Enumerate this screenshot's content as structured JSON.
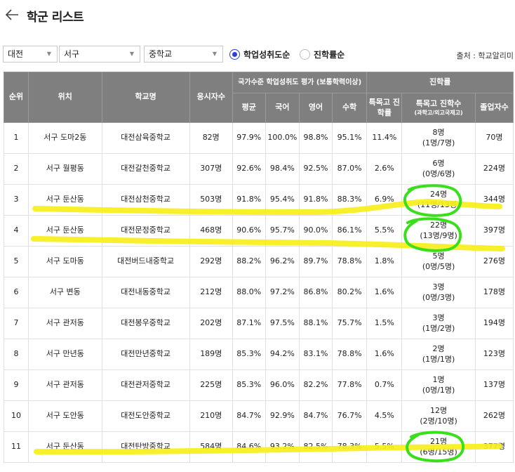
{
  "header": {
    "title": "학군 리스트"
  },
  "filters": {
    "city": "대전",
    "district": "서구",
    "school_type": "중학교",
    "sort_options": [
      {
        "label": "학업성취도순",
        "selected": true
      },
      {
        "label": "진학률순",
        "selected": false
      }
    ],
    "source": "출처 : 학교알리미"
  },
  "table": {
    "headers": {
      "rank": "순위",
      "location": "위치",
      "school": "학교명",
      "applicants": "응시자수",
      "achievement_group": "국가수준 학업성취도 평가 (보통학력이상)",
      "avg": "평균",
      "korean": "국어",
      "english": "영어",
      "math": "수학",
      "advancement_group": "진학률",
      "special_rate": "특목고 진학률",
      "special_count": "특목고 진학수",
      "special_count_sub": "(과학고/외고국제고)",
      "graduates": "졸업자수"
    },
    "rows": [
      {
        "rank": "1",
        "location": "서구 도마2동",
        "school": "대전삼육중학교",
        "applicants": "82명",
        "avg": "97.9%",
        "korean": "100.0%",
        "english": "98.8%",
        "math": "95.1%",
        "special_rate": "11.4%",
        "count": "8명",
        "count_detail": "(1명/7명)",
        "graduates": "70명"
      },
      {
        "rank": "2",
        "location": "서구 월평동",
        "school": "대전갈천중학교",
        "applicants": "307명",
        "avg": "92.6%",
        "korean": "98.4%",
        "english": "92.5%",
        "math": "87.0%",
        "special_rate": "2.6%",
        "count": "6명",
        "count_detail": "(0명/6명)",
        "graduates": "224명"
      },
      {
        "rank": "3",
        "location": "서구 둔산동",
        "school": "대전삼천중학교",
        "applicants": "503명",
        "avg": "91.8%",
        "korean": "95.4%",
        "english": "91.8%",
        "math": "88.3%",
        "special_rate": "6.9%",
        "count": "24명",
        "count_detail": "(11명/13명)",
        "graduates": "344명"
      },
      {
        "rank": "4",
        "location": "서구 둔산동",
        "school": "대전문정중학교",
        "applicants": "468명",
        "avg": "90.6%",
        "korean": "95.7%",
        "english": "90.0%",
        "math": "86.1%",
        "special_rate": "5.5%",
        "count": "22명",
        "count_detail": "(13명/9명)",
        "graduates": "397명"
      },
      {
        "rank": "5",
        "location": "서구 도마동",
        "school": "대전버드내중학교",
        "applicants": "292명",
        "avg": "88.2%",
        "korean": "96.2%",
        "english": "89.7%",
        "math": "78.8%",
        "special_rate": "1.8%",
        "count": "5명",
        "count_detail": "(0명/5명)",
        "graduates": "276명"
      },
      {
        "rank": "6",
        "location": "서구 변동",
        "school": "대전내동중학교",
        "applicants": "212명",
        "avg": "88.0%",
        "korean": "97.2%",
        "english": "86.8%",
        "math": "80.2%",
        "special_rate": "1.6%",
        "count": "3명",
        "count_detail": "(0명/3명)",
        "graduates": "178명"
      },
      {
        "rank": "7",
        "location": "서구 관저동",
        "school": "대전봉우중학교",
        "applicants": "202명",
        "avg": "87.1%",
        "korean": "97.5%",
        "english": "88.1%",
        "math": "75.7%",
        "special_rate": "1.5%",
        "count": "3명",
        "count_detail": "(1명/2명)",
        "graduates": "194명"
      },
      {
        "rank": "8",
        "location": "서구 만년동",
        "school": "대전만년중학교",
        "applicants": "189명",
        "avg": "85.3%",
        "korean": "94.2%",
        "english": "83.1%",
        "math": "78.8%",
        "special_rate": "1.6%",
        "count": "2명",
        "count_detail": "(1명/1명)",
        "graduates": "123명"
      },
      {
        "rank": "9",
        "location": "서구 관저동",
        "school": "대전관저중학교",
        "applicants": "225명",
        "avg": "85.3%",
        "korean": "96.0%",
        "english": "82.2%",
        "math": "77.8%",
        "special_rate": "0.7%",
        "count": "1명",
        "count_detail": "(0명/1명)",
        "graduates": "137명"
      },
      {
        "rank": "10",
        "location": "서구 도안동",
        "school": "대전도안중학교",
        "applicants": "210명",
        "avg": "84.7%",
        "korean": "92.9%",
        "english": "84.7%",
        "math": "76.7%",
        "special_rate": "4.5%",
        "count": "12명",
        "count_detail": "(2명/10명)",
        "graduates": "262명"
      },
      {
        "rank": "11",
        "location": "서구 둔산동",
        "school": "대전탄방중학교",
        "applicants": "584명",
        "avg": "84.6%",
        "korean": "93.2%",
        "english": "82.5%",
        "math": "78.3%",
        "special_rate": "5.5%",
        "count": "21명",
        "count_detail": "(6명/15명)",
        "graduates": "377명"
      }
    ]
  },
  "annotations": {
    "highlighter_color": "#f7ef1a",
    "circle_color": "#3adf1c"
  }
}
